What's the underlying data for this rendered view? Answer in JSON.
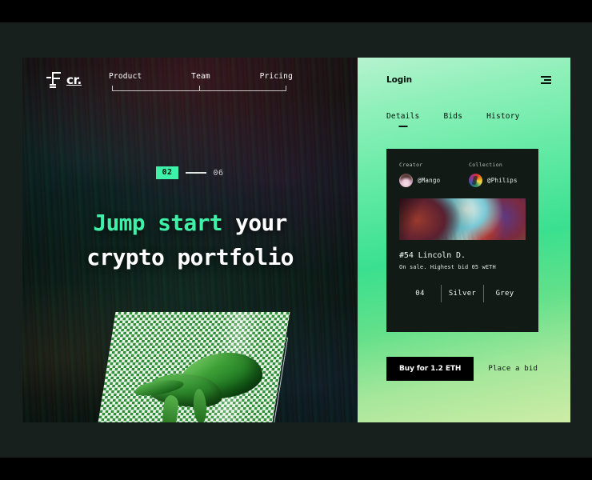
{
  "brand": {
    "logo_text": "cr.",
    "logo_icon": "f-mark-logo"
  },
  "hero": {
    "nav": [
      {
        "label": "Product"
      },
      {
        "label": "Team"
      },
      {
        "label": "Pricing"
      }
    ],
    "counter": {
      "current": "02",
      "total": "06"
    },
    "headline": {
      "accent": "Jump start",
      "rest": " your",
      "line2": "crypto portfolio"
    },
    "artwork_alt": "green-3d-figure-on-checkered-plate"
  },
  "panel": {
    "login_label": "Login",
    "menu_icon": "hamburger-menu-icon",
    "tabs": [
      {
        "label": "Details",
        "active": true
      },
      {
        "label": "Bids",
        "active": false
      },
      {
        "label": "History",
        "active": false
      }
    ],
    "card": {
      "creator_label": "Creator",
      "creator_name": "@Mango",
      "creator_avatar": "portrait-avatar",
      "collection_label": "Collection",
      "collection_name": "@Philips",
      "collection_avatar": "abstract-avatar",
      "artwork_alt": "abstract-colorful-nft-artwork",
      "title": "#54 Lincoln D.",
      "subtitle": "On sale. Highest bid 05 wETH",
      "attributes": [
        "04",
        "Silver",
        "Grey"
      ]
    },
    "actions": {
      "buy_label": "Buy for 1.2 ETH",
      "bid_label": "Place a bid"
    }
  },
  "colors": {
    "accent_green": "#3ef0a8",
    "panel_green": "#3ae08f",
    "card_dark": "#111a14",
    "page_dark": "#17201c",
    "hero_dark": "#060807"
  }
}
